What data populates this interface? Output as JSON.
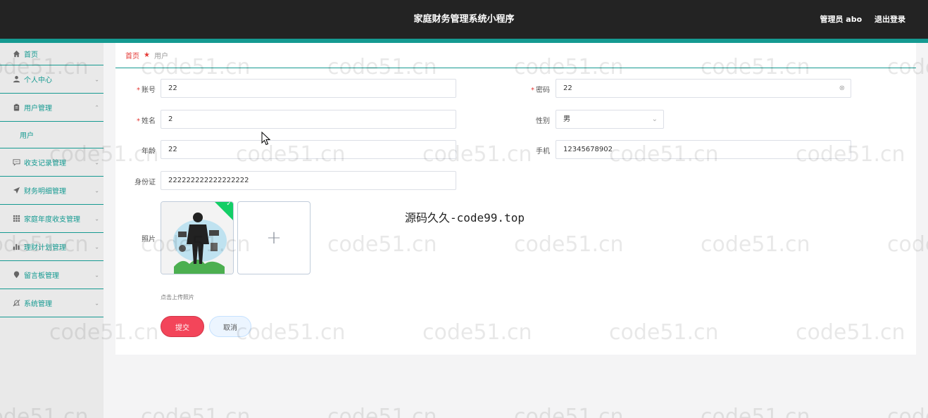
{
  "header": {
    "title": "家庭财务管理系统小程序",
    "user_label": "管理员 abo",
    "logout_label": "退出登录"
  },
  "sidebar": {
    "items": [
      {
        "label": "首页",
        "icon": "home-icon"
      },
      {
        "label": "个人中心",
        "icon": "user-icon"
      },
      {
        "label": "用户管理",
        "icon": "clipboard-icon",
        "expanded": true,
        "children": [
          {
            "label": "用户"
          }
        ]
      },
      {
        "label": "收支记录管理",
        "icon": "chat-icon"
      },
      {
        "label": "财务明细管理",
        "icon": "send-icon"
      },
      {
        "label": "家庭年度收支管理",
        "icon": "grid-icon"
      },
      {
        "label": "理财计划管理",
        "icon": "bar-chart-icon"
      },
      {
        "label": "留言板管理",
        "icon": "location-icon"
      },
      {
        "label": "系统管理",
        "icon": "bell-off-icon"
      }
    ]
  },
  "breadcrumb": {
    "home": "首页",
    "current": "用户"
  },
  "form": {
    "account": {
      "label": "账号",
      "value": "22",
      "required": true
    },
    "password": {
      "label": "密码",
      "value": "22",
      "required": true
    },
    "name": {
      "label": "姓名",
      "value": "2",
      "required": true
    },
    "gender": {
      "label": "性别",
      "value": "男"
    },
    "age": {
      "label": "年龄",
      "value": "22"
    },
    "phone": {
      "label": "手机",
      "value": "12345678902"
    },
    "id_card": {
      "label": "身份证",
      "value": "222222222222222222"
    },
    "photo": {
      "label": "照片",
      "hint": "点击上传照片"
    }
  },
  "buttons": {
    "submit": "提交",
    "cancel": "取消"
  },
  "overlay": {
    "promo": "源码久久-code99.top",
    "watermark": "code51.cn"
  },
  "colors": {
    "topbar": "#232323",
    "accent": "#159a91",
    "danger": "#f3455a"
  }
}
